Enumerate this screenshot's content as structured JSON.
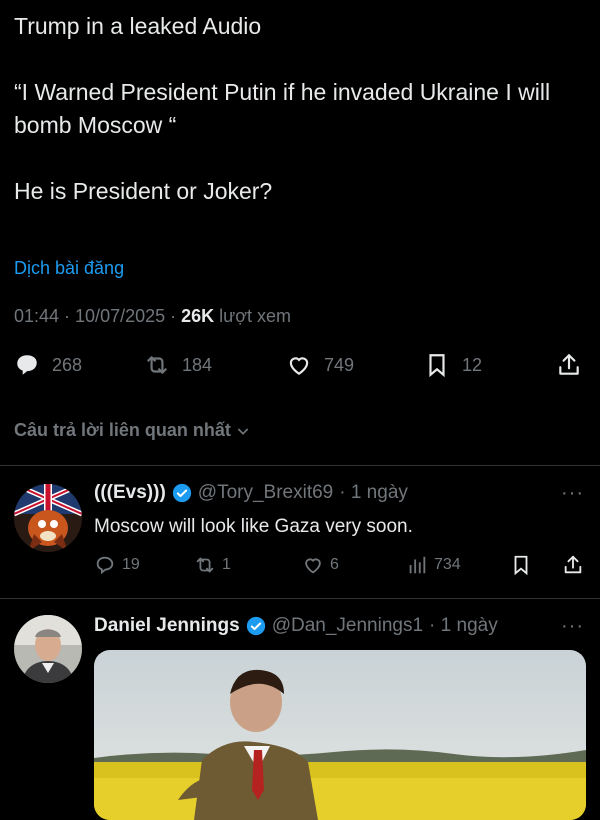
{
  "post": {
    "lines": [
      "Trump in a leaked Audio",
      "“I Warned President Putin if he invaded Ukraine I will bomb Moscow “",
      "He is President or Joker?"
    ],
    "translate_link": "Dịch bài đăng",
    "time": "01:44 · 10/07/2025 · ",
    "views": "26K",
    "views_label": " lượt xem",
    "actions": {
      "replies": "268",
      "reposts": "184",
      "likes": "749",
      "bookmarks": "12"
    }
  },
  "sort_label": "Câu trả lời liên quan nhất",
  "replies": [
    {
      "name": "(((Evs)))",
      "handle": "@Tory_Brexit69",
      "time": "· 1 ngày",
      "text": "Moscow will look like Gaza very soon.",
      "replies": "19",
      "reposts": "1",
      "likes": "6",
      "views": "734"
    },
    {
      "name": "Daniel Jennings",
      "handle": "@Dan_Jennings1",
      "time": "· 1 ngày"
    }
  ],
  "more_label": "···",
  "colors": {
    "accent": "#1d9bf0",
    "muted": "#71767b",
    "text": "#e7e9ea",
    "bg": "#000000"
  }
}
